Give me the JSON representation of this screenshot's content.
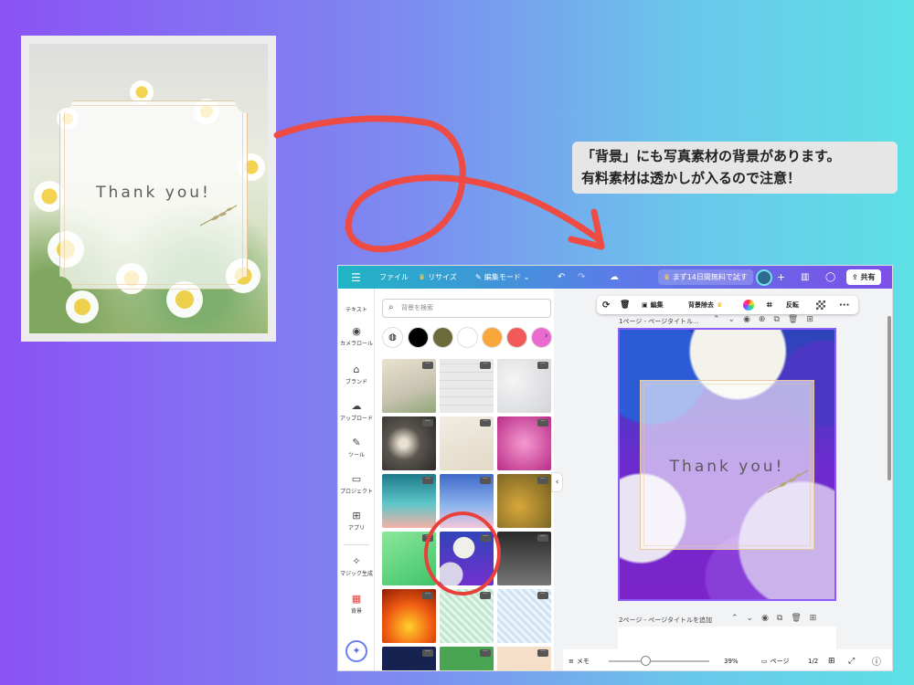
{
  "example": {
    "thank_text": "Thank you!"
  },
  "callout": {
    "line1": "「背景」にも写真素材の背景があります。",
    "line2": "有料素材は透かしが入るので注意！"
  },
  "editor": {
    "topbar": {
      "file": "ファイル",
      "resize": "リサイズ",
      "edit_mode": "編集モード",
      "trial": "まず14日間無料で試す",
      "share": "共有"
    },
    "rail": [
      {
        "label": "テキスト",
        "icon": "text-icon"
      },
      {
        "label": "カメラロール",
        "icon": "camera-icon"
      },
      {
        "label": "ブランド",
        "icon": "brand-icon"
      },
      {
        "label": "アップロード",
        "icon": "upload-icon"
      },
      {
        "label": "ツール",
        "icon": "pen-icon"
      },
      {
        "label": "プロジェクト",
        "icon": "folder-icon"
      },
      {
        "label": "アプリ",
        "icon": "apps-icon"
      },
      {
        "label": "マジック生成",
        "icon": "magic-icon"
      },
      {
        "label": "背景",
        "icon": "background-icon"
      }
    ],
    "search_placeholder": "背景を検索",
    "swatches": [
      "#000000",
      "#6b6a3b",
      "#ffffff",
      "#f7a73b",
      "#f25a5a",
      "#e96bd0"
    ],
    "context_toolbar": {
      "edit": "編集",
      "remove_bg": "背景除去",
      "flip": "反転"
    },
    "page1_label": "1ページ - ページタイトル...",
    "page1_text": "Thank you!",
    "page2_label": "2ページ - ページタイトルを追加",
    "bottombar": {
      "memo": "メモ",
      "zoom": "39%",
      "page": "ページ",
      "page_count": "1/2"
    }
  },
  "colors": {
    "accent": "#8b5cf6",
    "highlight_circle": "#e8413b",
    "arrow": "#ef4b45"
  }
}
